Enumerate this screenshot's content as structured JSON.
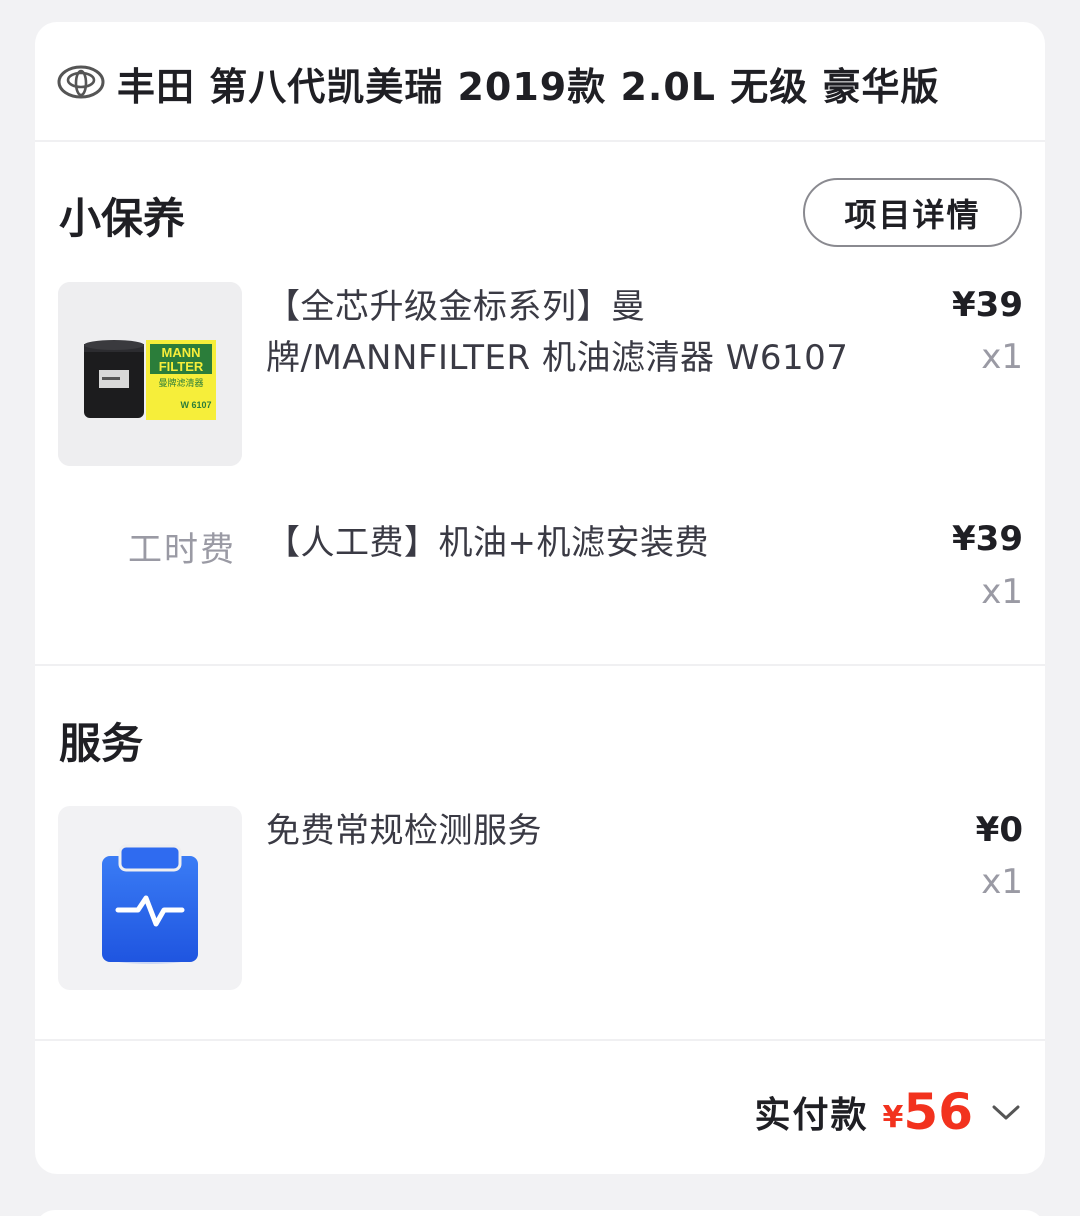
{
  "car": {
    "title": "丰田 第八代凯美瑞 2019款 2.0L 无级 豪华版",
    "logo_icon": "toyota-logo"
  },
  "maintenance": {
    "section_title": "小保养",
    "detail_button_label": "项目详情",
    "parts": [
      {
        "name": "【全芯升级金标系列】曼牌/MANNFILTER 机油滤清器 W6107",
        "price": "¥39",
        "qty": "x1",
        "image": {
          "brand_top": "MANN",
          "brand_bottom": "FILTER",
          "box_cn": "曼牌滤清器",
          "model": "W 6107"
        }
      }
    ],
    "labor": {
      "tag": "工时费",
      "name": "【人工费】机油+机滤安装费",
      "price": "¥39",
      "qty": "x1"
    }
  },
  "service": {
    "section_title": "服务",
    "items": [
      {
        "name": "免费常规检测服务",
        "price": "¥0",
        "qty": "x1",
        "icon": "clipboard-pulse-icon"
      }
    ]
  },
  "total": {
    "label": "实付款",
    "currency": "¥",
    "amount": "56",
    "expand_icon": "chevron-down-icon"
  },
  "colors": {
    "accent_red": "#f2321e",
    "service_icon_blue": "#2f6bf0"
  }
}
